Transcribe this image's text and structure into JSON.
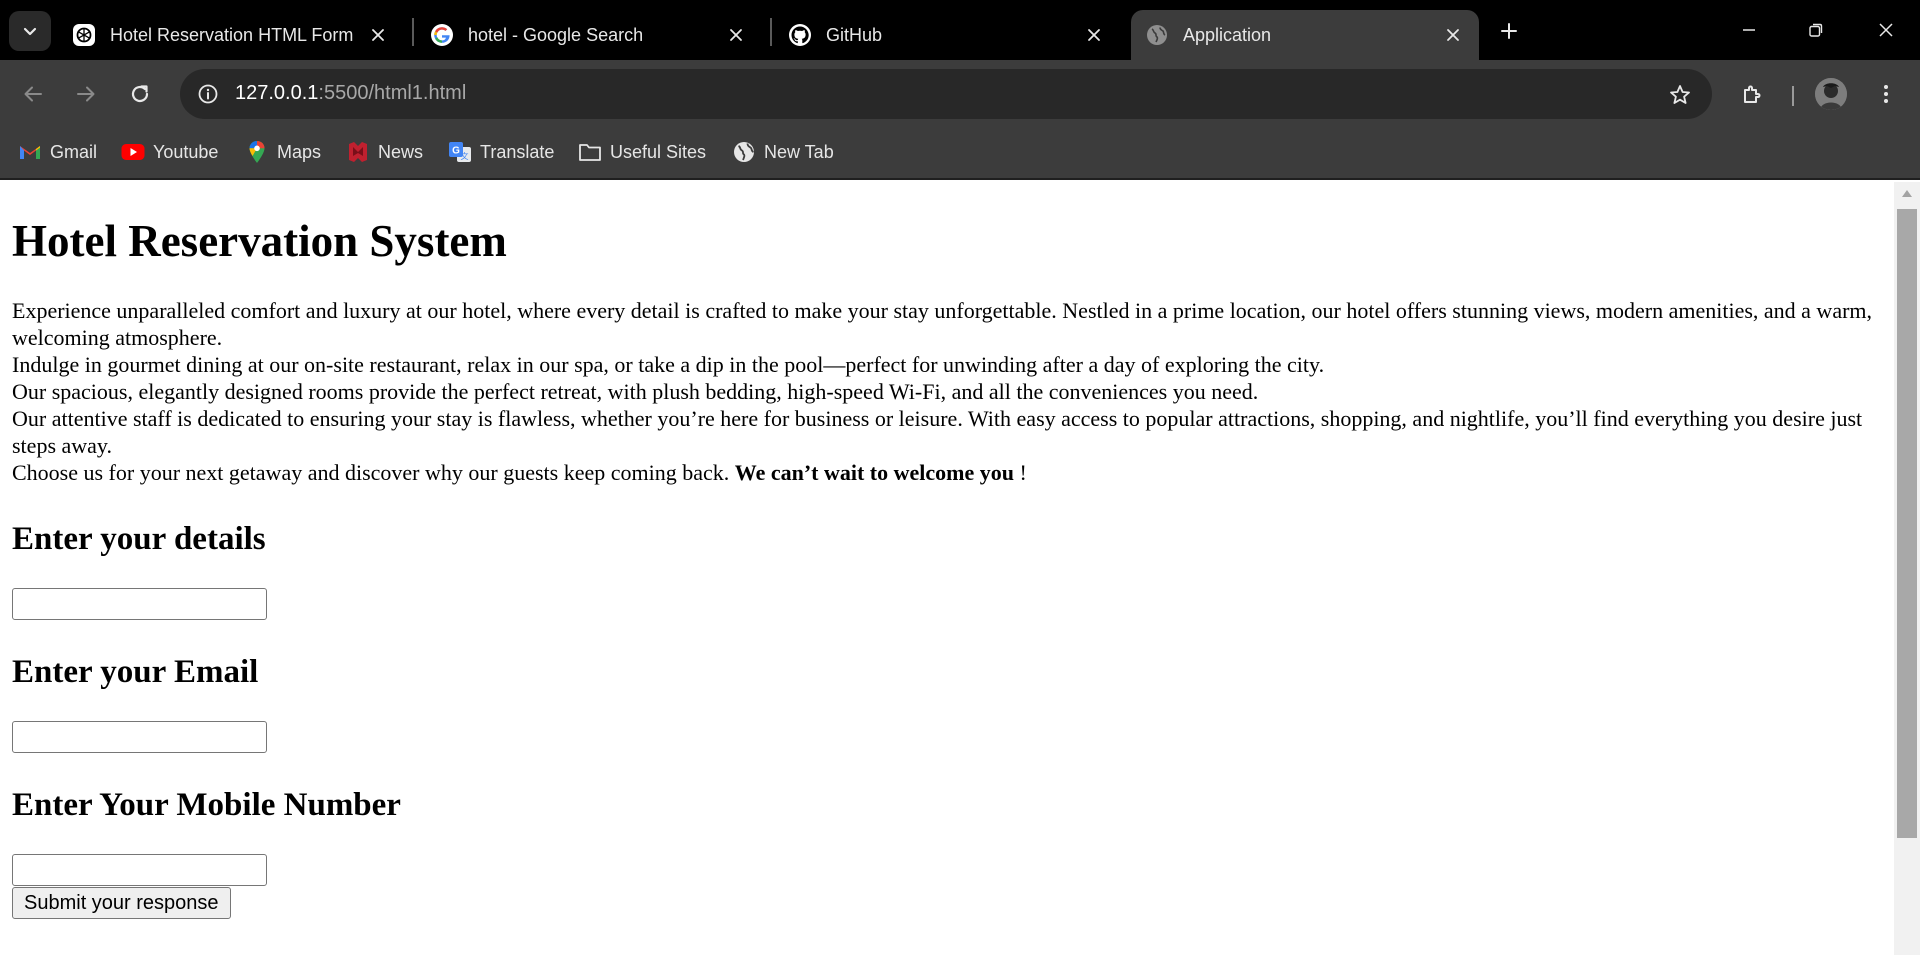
{
  "browser": {
    "tabs": [
      {
        "title": "Hotel Reservation HTML Form",
        "icon": "chatgpt-icon",
        "active": false
      },
      {
        "title": "hotel - Google Search",
        "icon": "google-icon",
        "active": false
      },
      {
        "title": "GitHub",
        "icon": "github-icon",
        "active": false
      },
      {
        "title": "Application",
        "icon": "globe-icon",
        "active": true
      }
    ],
    "address_bar": {
      "host": "127.0.0.1",
      "path": ":5500/html1.html"
    },
    "bookmarks": [
      {
        "label": "Gmail",
        "icon": "gmail-icon"
      },
      {
        "label": "Youtube",
        "icon": "youtube-icon"
      },
      {
        "label": "Maps",
        "icon": "maps-icon"
      },
      {
        "label": "News",
        "icon": "news-icon"
      },
      {
        "label": "Translate",
        "icon": "translate-icon"
      },
      {
        "label": "Useful Sites",
        "icon": "folder-icon"
      },
      {
        "label": "New Tab",
        "icon": "globe-icon"
      }
    ],
    "colors": {
      "titlebar": "#000000",
      "toolbar": "#3c3c3c",
      "omnibox": "#282828"
    }
  },
  "page": {
    "title": "Hotel Reservation System",
    "intro": {
      "p1": "Experience unparalleled comfort and luxury at our hotel, where every detail is crafted to make your stay unforgettable. Nestled in a prime location, our hotel offers stunning views, modern amenities, and a warm, welcoming atmosphere.",
      "p2": "Indulge in gourmet dining at our on-site restaurant, relax in our spa, or take a dip in the pool—perfect for unwinding after a day of exploring the city.",
      "p3": "Our spacious, elegantly designed rooms provide the perfect retreat, with plush bedding, high-speed Wi-Fi, and all the conveniences you need.",
      "p4": "Our attentive staff is dedicated to ensuring your stay is flawless, whether you’re here for business or leisure. With easy access to popular attractions, shopping, and nightlife, you’ll find everything you desire just steps away.",
      "p5_start": "Choose us for your next getaway and discover why our guests keep coming back. ",
      "p5_bold": "We can’t wait to welcome you",
      "p5_end": " !"
    },
    "form": {
      "details_heading": "Enter your details",
      "details_value": "",
      "email_heading": "Enter your Email",
      "email_value": "",
      "mobile_heading": "Enter Your Mobile Number",
      "mobile_value": "",
      "submit_label": "Submit your response"
    }
  }
}
